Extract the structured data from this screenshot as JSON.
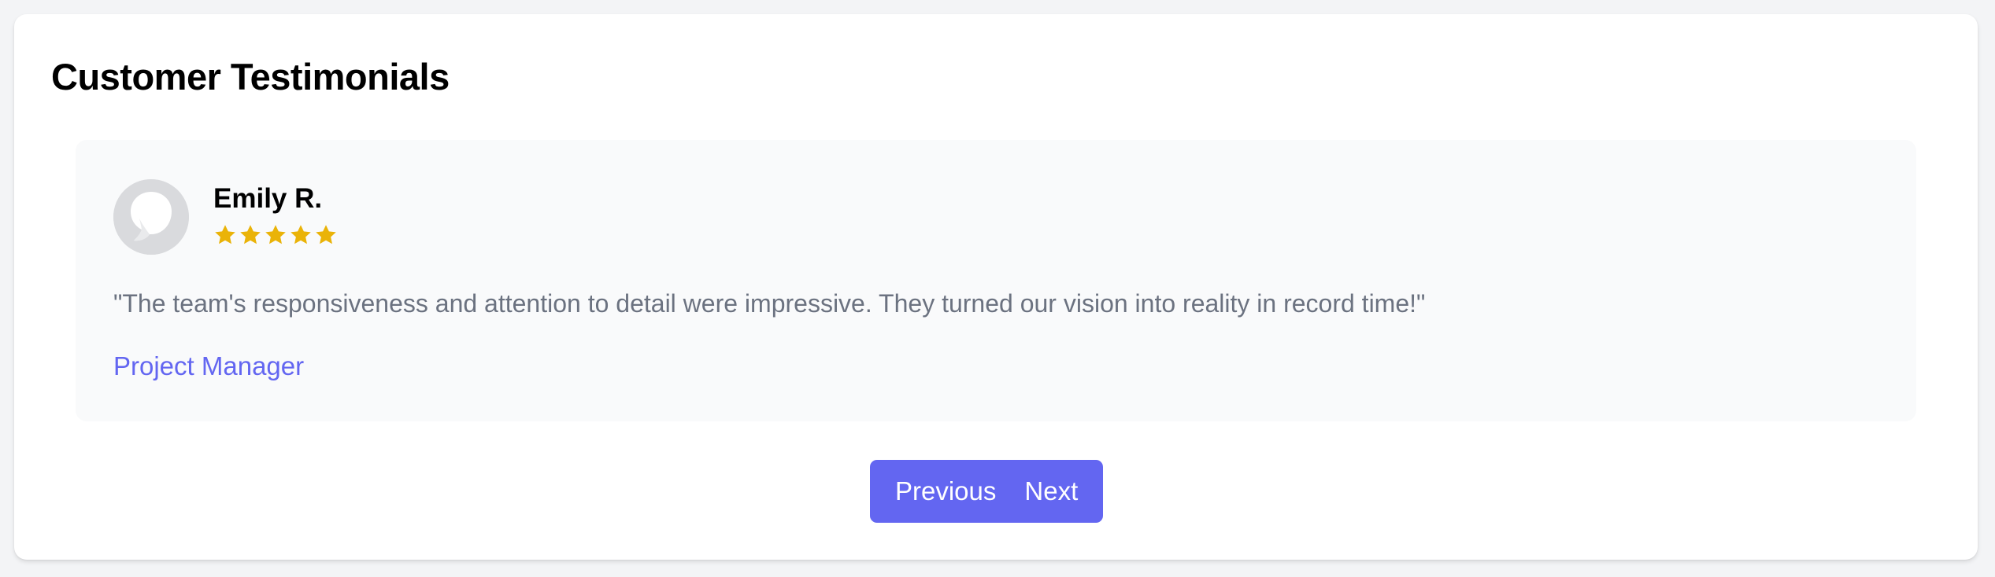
{
  "section": {
    "title": "Customer Testimonials"
  },
  "testimonial": {
    "author": "Emily R.",
    "rating": 5,
    "rating_max": 5,
    "quote": "\"The team's responsiveness and attention to detail were impressive. They turned our vision into reality in record time!\"",
    "role": "Project Manager"
  },
  "navigation": {
    "previous_label": "Previous",
    "next_label": "Next"
  },
  "colors": {
    "accent": "#6366f1",
    "star": "#eab308",
    "muted_text": "#6b7280",
    "avatar_bg": "#d9dadd",
    "card_bg": "#ffffff",
    "panel_bg": "#f9fafb",
    "page_bg": "#f3f4f6"
  },
  "icons": {
    "avatar": "user-avatar-placeholder-icon",
    "star": "star-icon"
  }
}
